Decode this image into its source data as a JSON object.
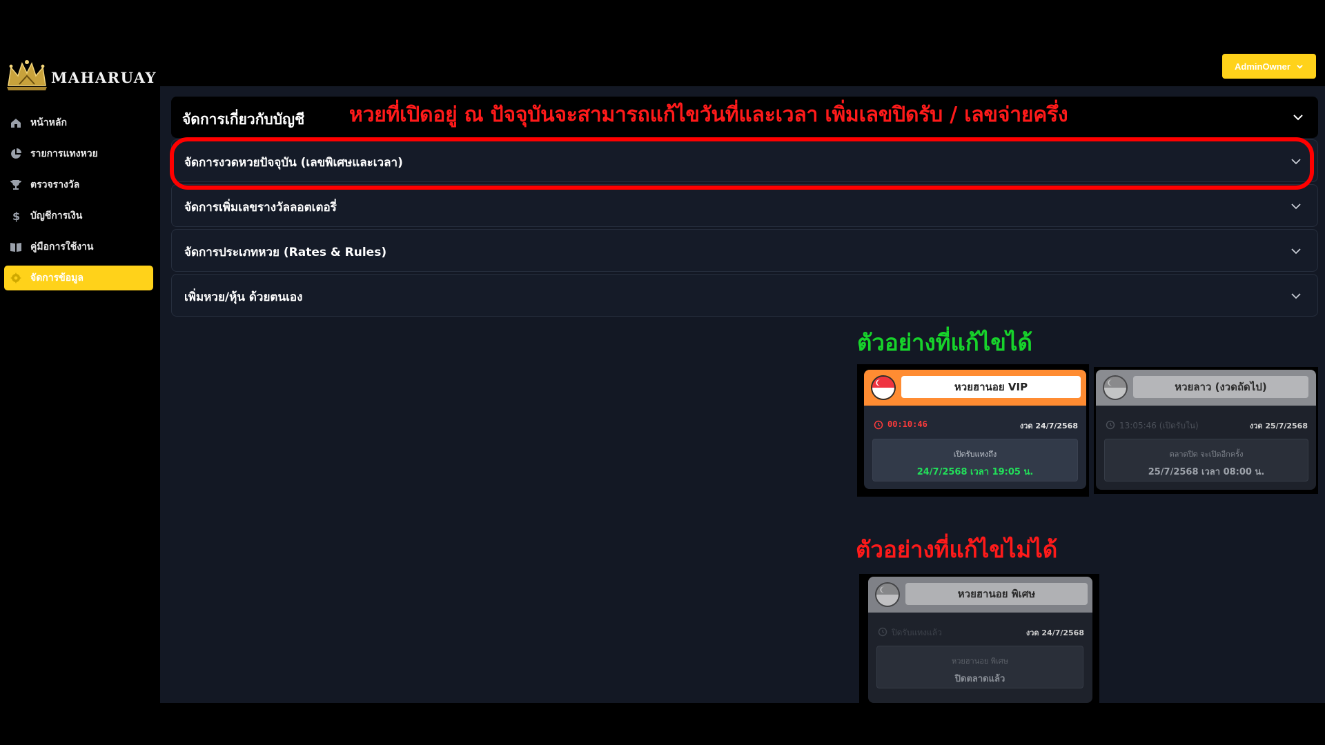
{
  "brand": {
    "name": "MAHARUAY",
    "accent": "#ffd21a"
  },
  "user": {
    "label": "AdminOwner"
  },
  "sidebar": {
    "items": [
      {
        "label": "หน้าหลัก",
        "icon": "home-icon"
      },
      {
        "label": "รายการแทงหวย",
        "icon": "pie-chart-icon"
      },
      {
        "label": "ตรวจรางวัล",
        "icon": "trophy-icon"
      },
      {
        "label": "บัญชีการเงิน",
        "icon": "dollar-icon"
      },
      {
        "label": "คู่มือการใช้งาน",
        "icon": "book-icon"
      },
      {
        "label": "จัดการข้อมูล",
        "icon": "gear-icon",
        "active": true
      }
    ]
  },
  "accordion": {
    "header": "จัดการเกี่ยวกับบัญชี",
    "rows": [
      "จัดการงวดหวยปัจจุบัน (เลขพิเศษและเวลา)",
      "จัดการเพิ่มเลขรางวัลลอตเตอรี่",
      "จัดการประเภทหวย (Rates & Rules)",
      "เพิ่มหวย/หุ้น ด้วยตนเอง"
    ]
  },
  "annotations": {
    "top": "หวยที่เปิดอยู่ ณ ปัจจุบันจะสามารถแก้ไขวันที่และเวลา เพิ่มเลขปิดรับ / เลขจ่ายครึ่ง",
    "editable": "ตัวอย่างที่แก้ไขได้",
    "not_editable": "ตัวอย่างที่แก้ไขไม่ได้",
    "highlight_color": "#ff0000"
  },
  "cards": {
    "vip": {
      "name": "หวยฮานอย VIP",
      "timer": "00:10:46",
      "round": "งวด 24/7/2568",
      "info_label": "เปิดรับแทงถึง",
      "info_value": "24/7/2568  เวลา  19:05 น.",
      "color": "#ff8c32"
    },
    "lao": {
      "name": "หวยลาว (งวดถัดไป)",
      "status": "13:05:46 (เปิดรับใน)",
      "round": "งวด 25/7/2568",
      "info_label": "ตลาดปิด จะเปิดอีกครั้ง",
      "info_value": "25/7/2568  เวลา  08:00 น."
    },
    "special": {
      "name": "หวยฮานอย พิเศษ",
      "status": "ปิดรับแทงแล้ว",
      "round": "งวด 24/7/2568",
      "info_label": "หวยฮานอย พิเศษ",
      "info_value": "ปิดตลาดแล้ว"
    }
  }
}
